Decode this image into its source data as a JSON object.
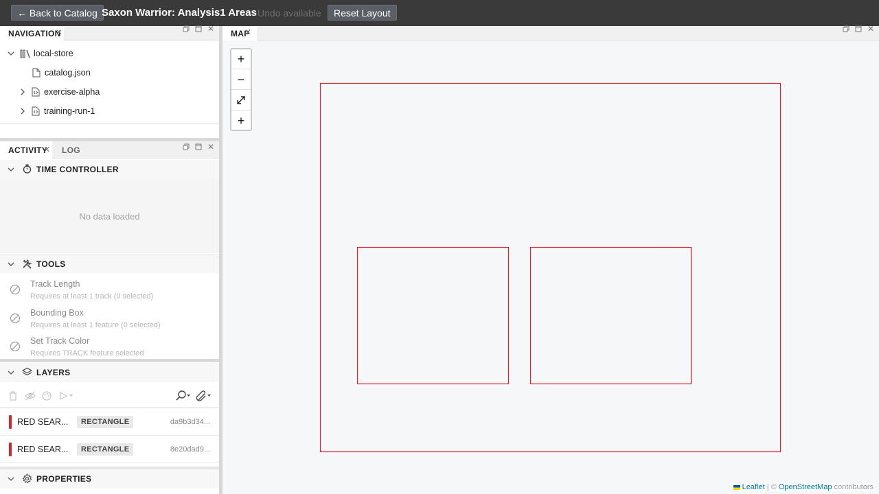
{
  "header": {
    "back_label": "← Back to Catalog",
    "title": "Saxon Warrior: Analysis1 Areas",
    "undo_label": "Undo available",
    "reset_label": "Reset Layout"
  },
  "navigation": {
    "tab_label": "NAVIGATION",
    "tree": [
      {
        "label": "local-store",
        "icon": "library-icon",
        "expanded": true
      },
      {
        "label": "catalog.json",
        "icon": "file-icon"
      },
      {
        "label": "exercise-alpha",
        "icon": "code-file-icon",
        "expandable": true
      },
      {
        "label": "training-run-1",
        "icon": "code-file-icon",
        "expandable": true
      }
    ]
  },
  "activity": {
    "tabs": [
      "ACTIVITY",
      "LOG"
    ],
    "time_controller": {
      "label": "TIME CONTROLLER",
      "empty_text": "No data loaded"
    },
    "tools": {
      "label": "TOOLS",
      "items": [
        {
          "name": "Track Length",
          "hint": "Requires at least 1 track (0 selected)"
        },
        {
          "name": "Bounding Box",
          "hint": "Requires at least 1 feature (0 selected)"
        },
        {
          "name": "Set Track Color",
          "hint": "Requires TRACK feature selected"
        }
      ]
    },
    "layers": {
      "label": "LAYERS",
      "items": [
        {
          "name": "RED SEAR...",
          "type": "RECTANGLE",
          "id": "da9b3d34...",
          "color": "#e0232b"
        },
        {
          "name": "RED SEAR...",
          "type": "RECTANGLE",
          "id": "8e20dad9...",
          "color": "#e0232b"
        }
      ]
    },
    "properties": {
      "label": "PROPERTIES"
    }
  },
  "map": {
    "tab_label": "MAP",
    "zoom_in": "+",
    "zoom_out": "−",
    "fit": "⤢",
    "add": "+",
    "attribution": {
      "leaflet": "Leaflet",
      "sep": " | © ",
      "osm": "OpenStreetMap",
      "suffix": " contributors"
    },
    "shape_color": "#e0232b"
  }
}
